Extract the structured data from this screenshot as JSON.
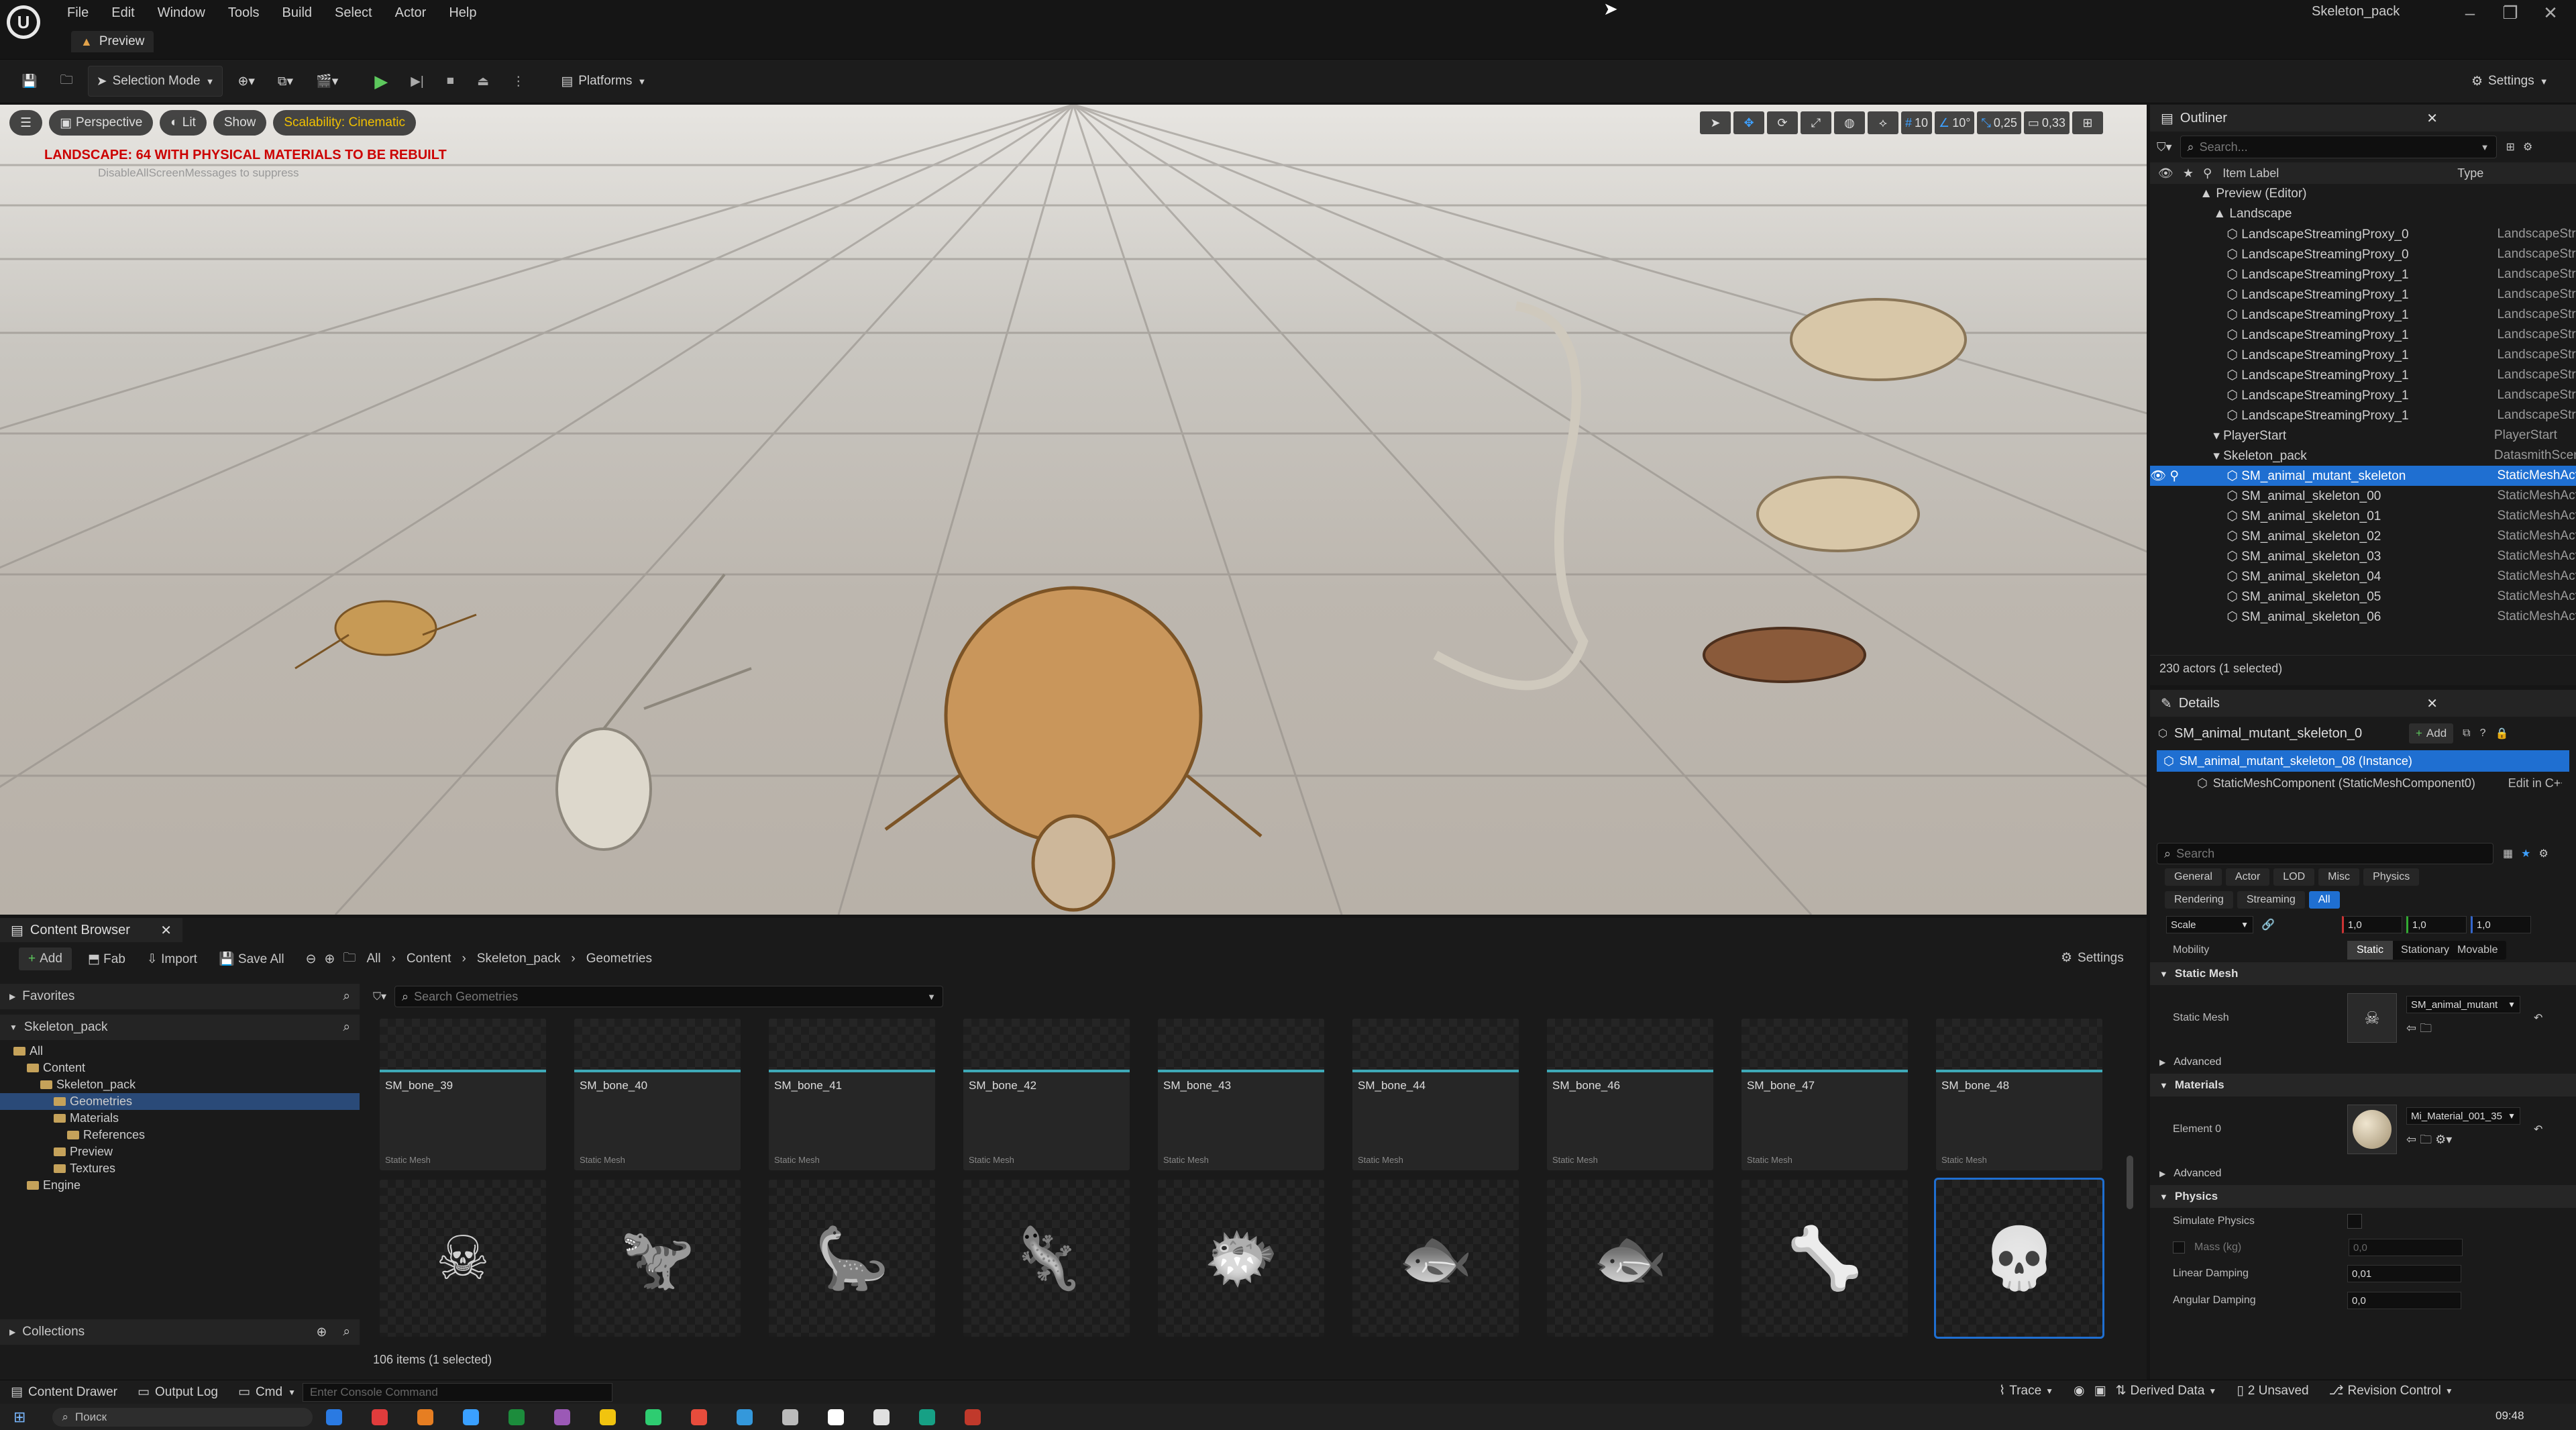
{
  "app": {
    "window_title": "Skeleton_pack",
    "menu": [
      "File",
      "Edit",
      "Window",
      "Tools",
      "Build",
      "Select",
      "Actor",
      "Help"
    ],
    "level_tab": "Preview"
  },
  "toolbar": {
    "selection_mode": "Selection Mode",
    "platforms": "Platforms",
    "settings": "Settings"
  },
  "viewport": {
    "perspective": "Perspective",
    "lit": "Lit",
    "show": "Show",
    "scalability": "Scalability: Cinematic",
    "warning": "LANDSCAPE: 64 WITH PHYSICAL MATERIALS TO BE REBUILT",
    "suppress_hint": "DisableAllScreenMessages to suppress",
    "grid_snap": "10",
    "rot_snap": "10°",
    "scale_snap": "0,25",
    "camera_speed": "0,33"
  },
  "outliner": {
    "tab": "Outliner",
    "search_placeholder": "Search...",
    "col_label": "Item Label",
    "col_type": "Type",
    "rows": [
      {
        "label": "Preview (Editor)",
        "type": "",
        "indent": 0,
        "sel": false
      },
      {
        "label": "Landscape",
        "type": "",
        "indent": 1,
        "sel": false
      },
      {
        "label": "LandscapeStreamingProxy_0",
        "type": "LandscapeStre",
        "indent": 2,
        "sel": false
      },
      {
        "label": "LandscapeStreamingProxy_0",
        "type": "LandscapeStre",
        "indent": 2,
        "sel": false
      },
      {
        "label": "LandscapeStreamingProxy_1",
        "type": "LandscapeStre",
        "indent": 2,
        "sel": false
      },
      {
        "label": "LandscapeStreamingProxy_1",
        "type": "LandscapeStre",
        "indent": 2,
        "sel": false
      },
      {
        "label": "LandscapeStreamingProxy_1",
        "type": "LandscapeStre",
        "indent": 2,
        "sel": false
      },
      {
        "label": "LandscapeStreamingProxy_1",
        "type": "LandscapeStre",
        "indent": 2,
        "sel": false
      },
      {
        "label": "LandscapeStreamingProxy_1",
        "type": "LandscapeStre",
        "indent": 2,
        "sel": false
      },
      {
        "label": "LandscapeStreamingProxy_1",
        "type": "LandscapeStre",
        "indent": 2,
        "sel": false
      },
      {
        "label": "LandscapeStreamingProxy_1",
        "type": "LandscapeStre",
        "indent": 2,
        "sel": false
      },
      {
        "label": "LandscapeStreamingProxy_1",
        "type": "LandscapeStre",
        "indent": 2,
        "sel": false
      },
      {
        "label": "PlayerStart",
        "type": "PlayerStart",
        "indent": 1,
        "sel": false
      },
      {
        "label": "Skeleton_pack",
        "type": "DatasmithScen",
        "indent": 1,
        "sel": false
      },
      {
        "label": "SM_animal_mutant_skeleton",
        "type": "StaticMeshAct",
        "indent": 2,
        "sel": true
      },
      {
        "label": "SM_animal_skeleton_00",
        "type": "StaticMeshAct",
        "indent": 2,
        "sel": false
      },
      {
        "label": "SM_animal_skeleton_01",
        "type": "StaticMeshAct",
        "indent": 2,
        "sel": false
      },
      {
        "label": "SM_animal_skeleton_02",
        "type": "StaticMeshAct",
        "indent": 2,
        "sel": false
      },
      {
        "label": "SM_animal_skeleton_03",
        "type": "StaticMeshAct",
        "indent": 2,
        "sel": false
      },
      {
        "label": "SM_animal_skeleton_04",
        "type": "StaticMeshAct",
        "indent": 2,
        "sel": false
      },
      {
        "label": "SM_animal_skeleton_05",
        "type": "StaticMeshAct",
        "indent": 2,
        "sel": false
      },
      {
        "label": "SM_animal_skeleton_06",
        "type": "StaticMeshAct",
        "indent": 2,
        "sel": false
      }
    ],
    "footer": "230 actors (1 selected)"
  },
  "details": {
    "tab": "Details",
    "actor_name": "SM_animal_mutant_skeleton_0",
    "add": "Add",
    "instance_row": "SM_animal_mutant_skeleton_08 (Instance)",
    "component_row": "StaticMeshComponent (StaticMeshComponent0)",
    "edit_in": "Edit in C++",
    "search_placeholder": "Search",
    "filters_row1": [
      "General",
      "Actor",
      "LOD",
      "Misc",
      "Physics"
    ],
    "filters_row2": [
      "Rendering",
      "Streaming",
      "All"
    ],
    "scale_label": "Scale",
    "scale_values": [
      "1,0",
      "1,0",
      "1,0"
    ],
    "mobility_label": "Mobility",
    "mobility_options": [
      "Static",
      "Stationary",
      "Movable"
    ],
    "sec_static_mesh": "Static Mesh",
    "static_mesh_label": "Static Mesh",
    "static_mesh_value": "SM_animal_mutant",
    "advanced": "Advanced",
    "sec_materials": "Materials",
    "element0": "Element 0",
    "material_value": "Mi_Material_001_35",
    "sec_physics": "Physics",
    "simulate_physics": "Simulate Physics",
    "mass": "Mass (kg)",
    "mass_value": "0,0",
    "linear_damping": "Linear Damping",
    "linear_damping_value": "0,01",
    "angular_damping": "Angular Damping",
    "angular_damping_value": "0,0"
  },
  "content_browser": {
    "tab": "Content Browser",
    "add": "Add",
    "fab": "Fab",
    "import": "Import",
    "save_all": "Save All",
    "path": [
      "All",
      "Content",
      "Skeleton_pack",
      "Geometries"
    ],
    "settings": "Settings",
    "favorites": "Favorites",
    "root": "Skeleton_pack",
    "search_placeholder": "Search Geometries",
    "tree": [
      {
        "label": "All",
        "indent": 0,
        "sel": false
      },
      {
        "label": "Content",
        "indent": 1,
        "sel": false
      },
      {
        "label": "Skeleton_pack",
        "indent": 2,
        "sel": false
      },
      {
        "label": "Geometries",
        "indent": 3,
        "sel": true
      },
      {
        "label": "Materials",
        "indent": 3,
        "sel": false
      },
      {
        "label": "References",
        "indent": 4,
        "sel": false
      },
      {
        "label": "Preview",
        "indent": 3,
        "sel": false
      },
      {
        "label": "Textures",
        "indent": 3,
        "sel": false
      },
      {
        "label": "Engine",
        "indent": 1,
        "sel": false
      }
    ],
    "assets_row1": [
      {
        "name": "SM_bone_39",
        "kind": "Static Mesh"
      },
      {
        "name": "SM_bone_40",
        "kind": "Static Mesh"
      },
      {
        "name": "SM_bone_41",
        "kind": "Static Mesh"
      },
      {
        "name": "SM_bone_42",
        "kind": "Static Mesh"
      },
      {
        "name": "SM_bone_43",
        "kind": "Static Mesh"
      },
      {
        "name": "SM_bone_44",
        "kind": "Static Mesh"
      },
      {
        "name": "SM_bone_46",
        "kind": "Static Mesh"
      },
      {
        "name": "SM_bone_47",
        "kind": "Static Mesh"
      },
      {
        "name": "SM_bone_48",
        "kind": "Static Mesh"
      }
    ],
    "assets_row2_count": 9,
    "collections": "Collections",
    "footer": "106 items (1 selected)"
  },
  "statusbar": {
    "content_drawer": "Content Drawer",
    "output_log": "Output Log",
    "cmd": "Cmd",
    "console_placeholder": "Enter Console Command",
    "trace": "Trace",
    "derived_data": "Derived Data",
    "unsaved": "2 Unsaved",
    "revision_control": "Revision Control"
  },
  "taskbar": {
    "search": "Поиск",
    "time": "09:48"
  }
}
